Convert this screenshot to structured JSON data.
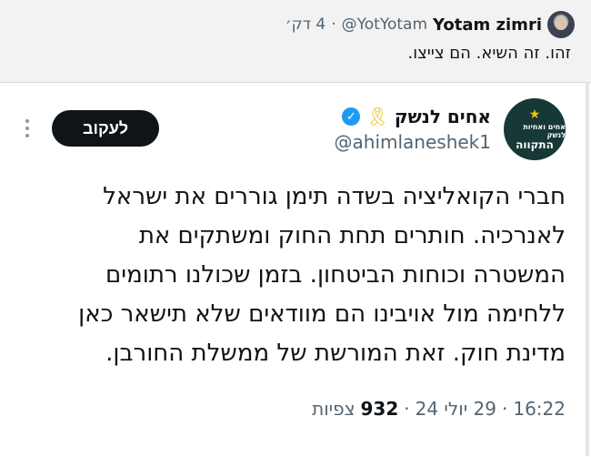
{
  "reply": {
    "name": "Yotam zimri",
    "handle": "@YotYotam",
    "separator": "·",
    "time": "4 דק׳",
    "text": "זהו. זה השיא. הם צייצו."
  },
  "tweet": {
    "author_name": "אחים לנשק",
    "ribbon_icon": "yellow-ribbon-icon",
    "verified_icon": "verified-badge-icon",
    "handle": "@ahimlaneshek1",
    "logo": {
      "line1": "אחים ואחיות לנשק",
      "line2": "התקווה"
    },
    "follow_label": "לעקוב",
    "body_lines": [
      "חברי הקואליציה בשדה תימן גוררים את ישראל",
      "לאנרכיה. חותרים תחת החוק ומשתקים את",
      "המשטרה וכוחות הביטחון. בזמן שכולנו רתומים",
      "ללחימה מול אויבינו הם מוודאים שלא תישאר כאן",
      "מדינת חוק. זאת המורשת של ממשלת החורבן."
    ],
    "time": "16:22",
    "date": "29 יולי 24",
    "views_count": "932",
    "views_label": "צפיות",
    "separator": "·"
  },
  "colors": {
    "accent_blue": "#1d9bf0",
    "ribbon_yellow": "#f4c20d",
    "follow_bg": "#0f1419",
    "muted_text": "#536471",
    "logo_bg": "#163836"
  }
}
